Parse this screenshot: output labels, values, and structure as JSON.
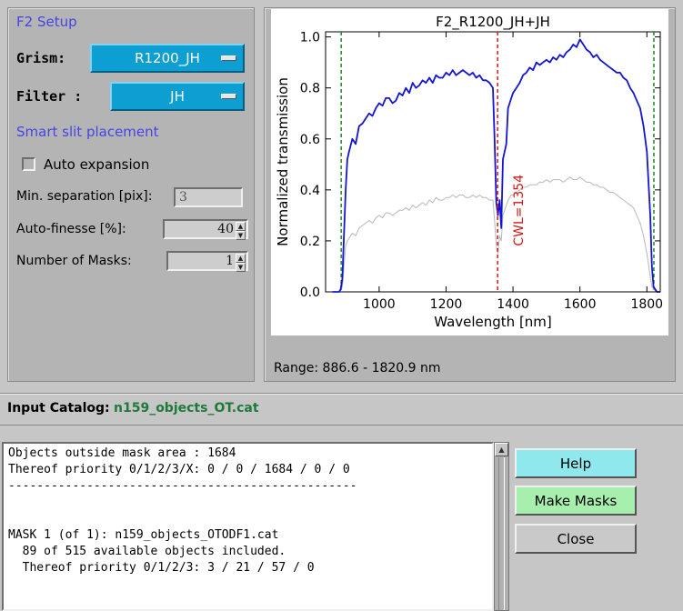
{
  "setup": {
    "title": "F2 Setup",
    "grism_label": "Grism:",
    "grism_value": "R1200_JH",
    "filter_label": "Filter :",
    "filter_value": "JH",
    "smart_slit_title": "Smart slit placement",
    "auto_expansion_label": "Auto expansion",
    "auto_expansion_checked": false,
    "min_sep_label": "Min. separation [pix]:",
    "min_sep_value": "3",
    "auto_finesse_label": "Auto-finesse [%]:",
    "auto_finesse_value": "40",
    "num_masks_label": "Number of Masks:",
    "num_masks_value": "1"
  },
  "plot": {
    "range_text": "Range: 886.6 - 1820.9 nm"
  },
  "chart_data": {
    "type": "line",
    "title": "F2_R1200_JH+JH",
    "xlabel": "Wavelength [nm]",
    "ylabel": "Normalized transmission",
    "xlim": [
      840,
      1840
    ],
    "ylim": [
      0,
      1.02
    ],
    "xticks": [
      "1000",
      "1200",
      "1400",
      "1600",
      "1800"
    ],
    "yticks": [
      "0.0",
      "0.2",
      "0.4",
      "0.6",
      "0.8",
      "1.0"
    ],
    "colors": {
      "primary": "#1414d2",
      "secondary": "#b8b8b8",
      "range_lines": "#1e8a1e",
      "cwl_line": "#cc1a1a"
    },
    "range_lines": [
      886.6,
      1820.9
    ],
    "cwl_line": 1354,
    "cwl_label": "CWL=1354",
    "series": [
      {
        "x": [
          860,
          880,
          885,
          890,
          900,
          905,
          910,
          920,
          930,
          940,
          950,
          960,
          970,
          980,
          990,
          1000,
          1010,
          1020,
          1030,
          1040,
          1050,
          1060,
          1070,
          1080,
          1090,
          1100,
          1110,
          1120,
          1130,
          1140,
          1150,
          1160,
          1170,
          1180,
          1190,
          1200,
          1210,
          1220,
          1230,
          1240,
          1250,
          1260,
          1270,
          1280,
          1290,
          1300,
          1310,
          1320,
          1330,
          1340,
          1345,
          1350,
          1355,
          1360,
          1365,
          1370,
          1380,
          1385,
          1390,
          1395,
          1400,
          1410,
          1420,
          1430,
          1440,
          1450,
          1460,
          1470,
          1480,
          1490,
          1500,
          1510,
          1520,
          1530,
          1540,
          1550,
          1560,
          1570,
          1580,
          1590,
          1600,
          1610,
          1620,
          1630,
          1640,
          1650,
          1660,
          1670,
          1680,
          1690,
          1700,
          1710,
          1720,
          1730,
          1740,
          1750,
          1760,
          1770,
          1780,
          1790,
          1800,
          1810,
          1815,
          1820,
          1830,
          1840
        ],
        "values": [
          0,
          0,
          0.01,
          0.05,
          0.4,
          0.52,
          0.55,
          0.6,
          0.58,
          0.65,
          0.66,
          0.68,
          0.7,
          0.69,
          0.72,
          0.74,
          0.73,
          0.76,
          0.76,
          0.74,
          0.75,
          0.78,
          0.77,
          0.8,
          0.78,
          0.82,
          0.8,
          0.81,
          0.83,
          0.82,
          0.84,
          0.82,
          0.85,
          0.84,
          0.84,
          0.86,
          0.85,
          0.87,
          0.85,
          0.86,
          0.87,
          0.86,
          0.85,
          0.86,
          0.84,
          0.85,
          0.83,
          0.83,
          0.82,
          0.8,
          0.6,
          0.35,
          0.3,
          0.36,
          0.25,
          0.52,
          0.58,
          0.72,
          0.74,
          0.76,
          0.78,
          0.8,
          0.82,
          0.85,
          0.86,
          0.88,
          0.87,
          0.9,
          0.89,
          0.9,
          0.91,
          0.9,
          0.92,
          0.91,
          0.93,
          0.92,
          0.94,
          0.95,
          0.97,
          0.96,
          0.99,
          0.97,
          0.95,
          0.94,
          0.92,
          0.93,
          0.91,
          0.9,
          0.89,
          0.88,
          0.87,
          0.86,
          0.86,
          0.84,
          0.83,
          0.8,
          0.78,
          0.75,
          0.72,
          0.65,
          0.55,
          0.3,
          0.1,
          0.02,
          0,
          0
        ]
      },
      {
        "x": [
          860,
          880,
          885,
          890,
          900,
          905,
          910,
          920,
          930,
          940,
          950,
          960,
          970,
          980,
          990,
          1000,
          1010,
          1020,
          1030,
          1040,
          1050,
          1060,
          1070,
          1080,
          1090,
          1100,
          1110,
          1120,
          1130,
          1140,
          1150,
          1160,
          1170,
          1180,
          1190,
          1200,
          1210,
          1220,
          1230,
          1240,
          1250,
          1260,
          1270,
          1280,
          1290,
          1300,
          1310,
          1320,
          1330,
          1340,
          1345,
          1350,
          1355,
          1360,
          1365,
          1370,
          1380,
          1385,
          1390,
          1395,
          1400,
          1410,
          1420,
          1430,
          1440,
          1450,
          1460,
          1470,
          1480,
          1490,
          1500,
          1510,
          1520,
          1530,
          1540,
          1550,
          1560,
          1570,
          1580,
          1590,
          1600,
          1610,
          1620,
          1630,
          1640,
          1650,
          1660,
          1670,
          1680,
          1690,
          1700,
          1710,
          1720,
          1730,
          1740,
          1750,
          1760,
          1770,
          1780,
          1790,
          1800,
          1810,
          1815,
          1820,
          1830,
          1840
        ],
        "values": [
          0,
          0,
          0.005,
          0.02,
          0.18,
          0.2,
          0.21,
          0.23,
          0.22,
          0.25,
          0.26,
          0.27,
          0.28,
          0.27,
          0.29,
          0.3,
          0.29,
          0.31,
          0.31,
          0.3,
          0.31,
          0.32,
          0.32,
          0.33,
          0.32,
          0.34,
          0.33,
          0.34,
          0.35,
          0.34,
          0.36,
          0.35,
          0.37,
          0.36,
          0.36,
          0.37,
          0.37,
          0.38,
          0.37,
          0.38,
          0.38,
          0.37,
          0.37,
          0.38,
          0.37,
          0.38,
          0.37,
          0.37,
          0.36,
          0.36,
          0.28,
          0.18,
          0.15,
          0.22,
          0.2,
          0.3,
          0.34,
          0.36,
          0.37,
          0.38,
          0.38,
          0.39,
          0.4,
          0.41,
          0.41,
          0.42,
          0.42,
          0.42,
          0.43,
          0.43,
          0.44,
          0.43,
          0.44,
          0.44,
          0.44,
          0.43,
          0.44,
          0.45,
          0.44,
          0.44,
          0.45,
          0.44,
          0.43,
          0.43,
          0.42,
          0.42,
          0.41,
          0.41,
          0.4,
          0.39,
          0.39,
          0.38,
          0.37,
          0.36,
          0.35,
          0.34,
          0.33,
          0.3,
          0.27,
          0.22,
          0.15,
          0.06,
          0.02,
          0.01,
          0,
          0
        ]
      }
    ]
  },
  "catalog": {
    "label": "Input Catalog:",
    "value": "n159_objects_OT.cat"
  },
  "output": {
    "text": "Objects outside mask area : 1684\nThereof priority 0/1/2/3/X: 0 / 0 / 1684 / 0 / 0\n-------------------------------------------------\n\n\nMASK 1 (of 1): n159_objects_OTODF1.cat\n  89 of 515 available objects included.\n  Thereof priority 0/1/2/3: 3 / 21 / 57 / 0"
  },
  "buttons": {
    "help": "Help",
    "make_masks": "Make Masks",
    "close": "Close"
  },
  "icons": {
    "scroll_up": "▲",
    "spin_up": "▲",
    "spin_down": "▼"
  }
}
